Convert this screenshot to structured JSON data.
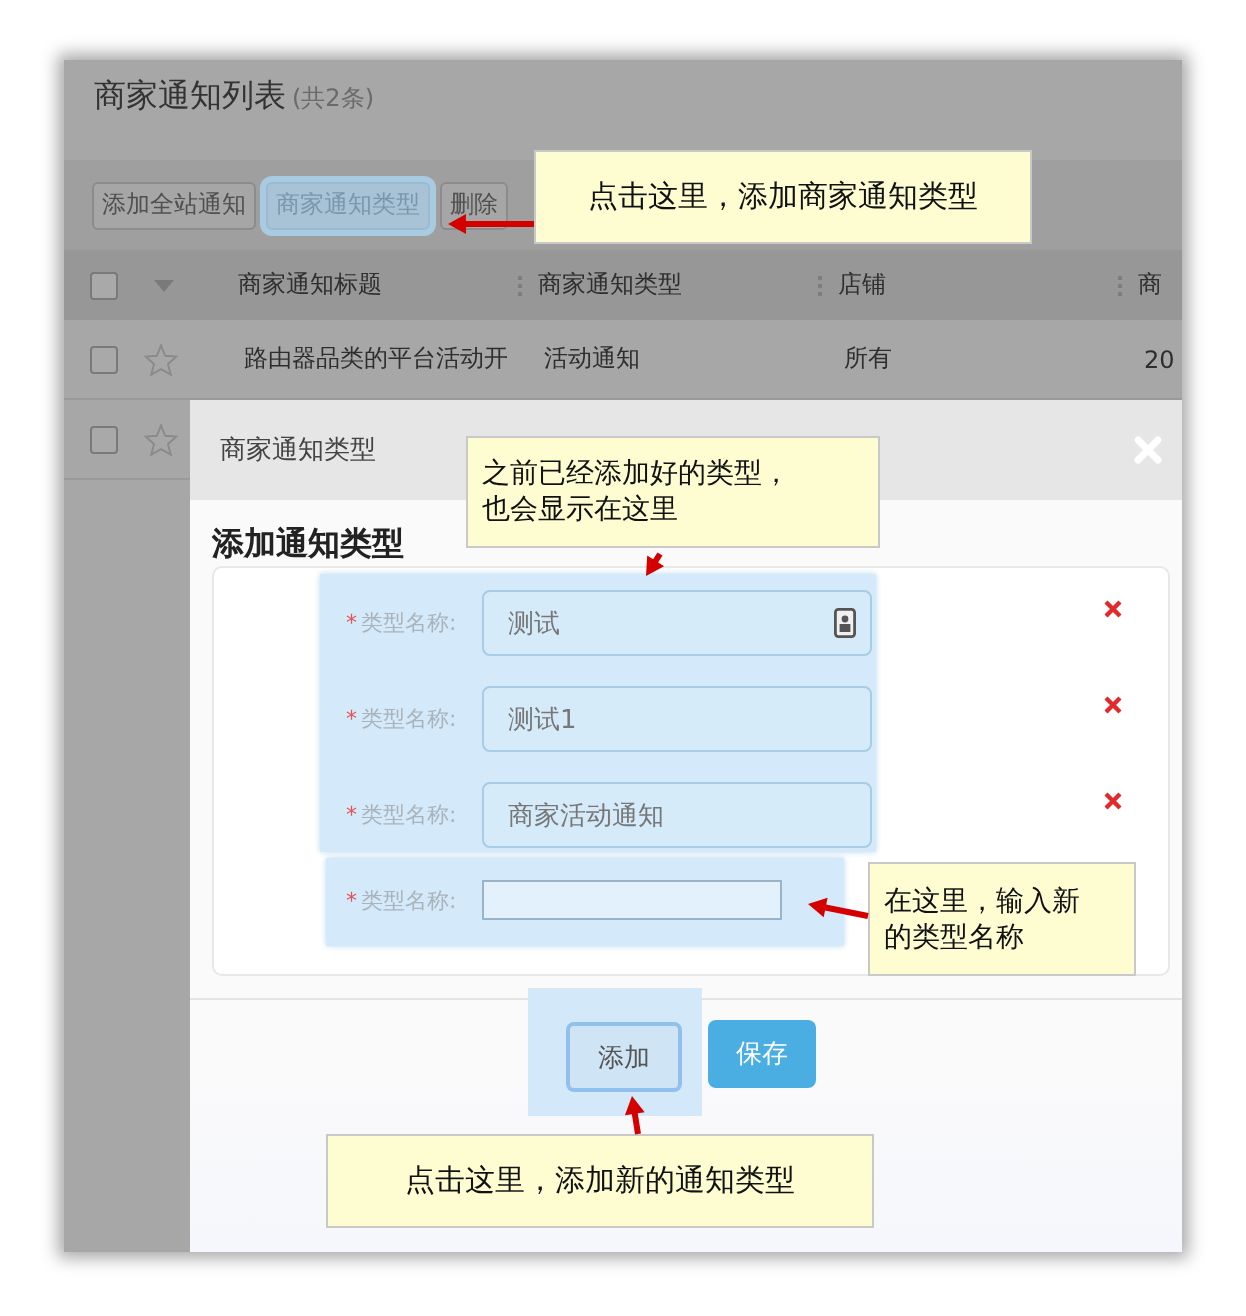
{
  "page": {
    "title": "商家通知列表",
    "count": "(共2条)"
  },
  "toolbar": [
    {
      "label": "添加全站通知",
      "highlighted": false
    },
    {
      "label": "商家通知类型",
      "highlighted": true
    },
    {
      "label": "删除",
      "highlighted": false
    }
  ],
  "table": {
    "select_all_checked": false,
    "columns": [
      "商家通知标题",
      "商家通知类型",
      "店铺",
      "商"
    ],
    "rows": [
      {
        "checked": false,
        "starred": false,
        "cells": [
          "路由器品类的平台活动开",
          "活动通知",
          "所有",
          "20"
        ]
      },
      {
        "checked": false,
        "starred": false
      }
    ]
  },
  "dialog": {
    "title": "商家通知类型",
    "heading": "添加通知类型",
    "field_groups": [
      {
        "highlighted": true,
        "fields": [
          {
            "required_mark": "*",
            "label": "类型名称:",
            "value": "测试",
            "removable": true,
            "autofill_icon": true
          },
          {
            "required_mark": "*",
            "label": "类型名称:",
            "value": "测试1",
            "removable": true,
            "autofill_icon": false
          },
          {
            "required_mark": "*",
            "label": "类型名称:",
            "value": "商家活动通知",
            "removable": true,
            "autofill_icon": false
          }
        ]
      },
      {
        "highlighted": true,
        "fields": [
          {
            "required_mark": "*",
            "label": "类型名称:",
            "autofill_icon": false
          }
        ]
      }
    ],
    "buttons": [
      {
        "label": "添加",
        "kind": "secondary",
        "highlighted": true
      },
      {
        "label": "保存",
        "kind": "primary",
        "highlighted": false
      }
    ]
  },
  "callouts": [
    {
      "lines": [
        "点击这里，添加商家通知类型"
      ]
    },
    {
      "lines": [
        "之前已经添加好的类型，",
        "也会显示在这里"
      ]
    },
    {
      "lines": [
        "在这里，输入新",
        "的类型名称"
      ]
    },
    {
      "lines": [
        "点击这里，添加新的通知类型"
      ]
    }
  ]
}
